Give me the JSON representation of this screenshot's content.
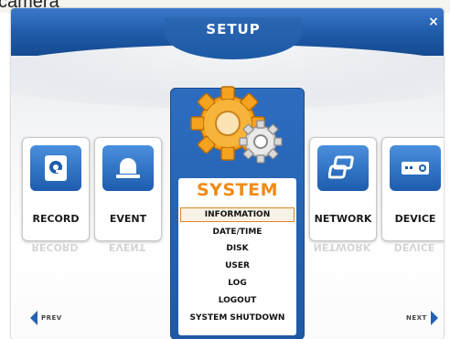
{
  "cropped_header_text": "camera",
  "window": {
    "title": "SETUP",
    "close_glyph": "×"
  },
  "tiles": [
    {
      "label": "RECORD",
      "icon": "disk-icon"
    },
    {
      "label": "EVENT",
      "icon": "alarm-icon"
    },
    {
      "label": "NETWORK",
      "icon": "network-icon"
    },
    {
      "label": "DEVICE",
      "icon": "projector-icon"
    }
  ],
  "system_menu": {
    "title": "SYSTEM",
    "icon": "gears-icon",
    "items": [
      "INFORMATION",
      "DATE/TIME",
      "DISK",
      "USER",
      "LOG",
      "LOGOUT",
      "SYSTEM SHUTDOWN"
    ],
    "selected": "INFORMATION"
  },
  "nav": {
    "prev_label": "PREV",
    "next_label": "NEXT"
  },
  "colors": {
    "accent_blue": "#1f5aa8",
    "menu_title_orange": "#f08a16",
    "gear_orange": "#f5a21f"
  }
}
